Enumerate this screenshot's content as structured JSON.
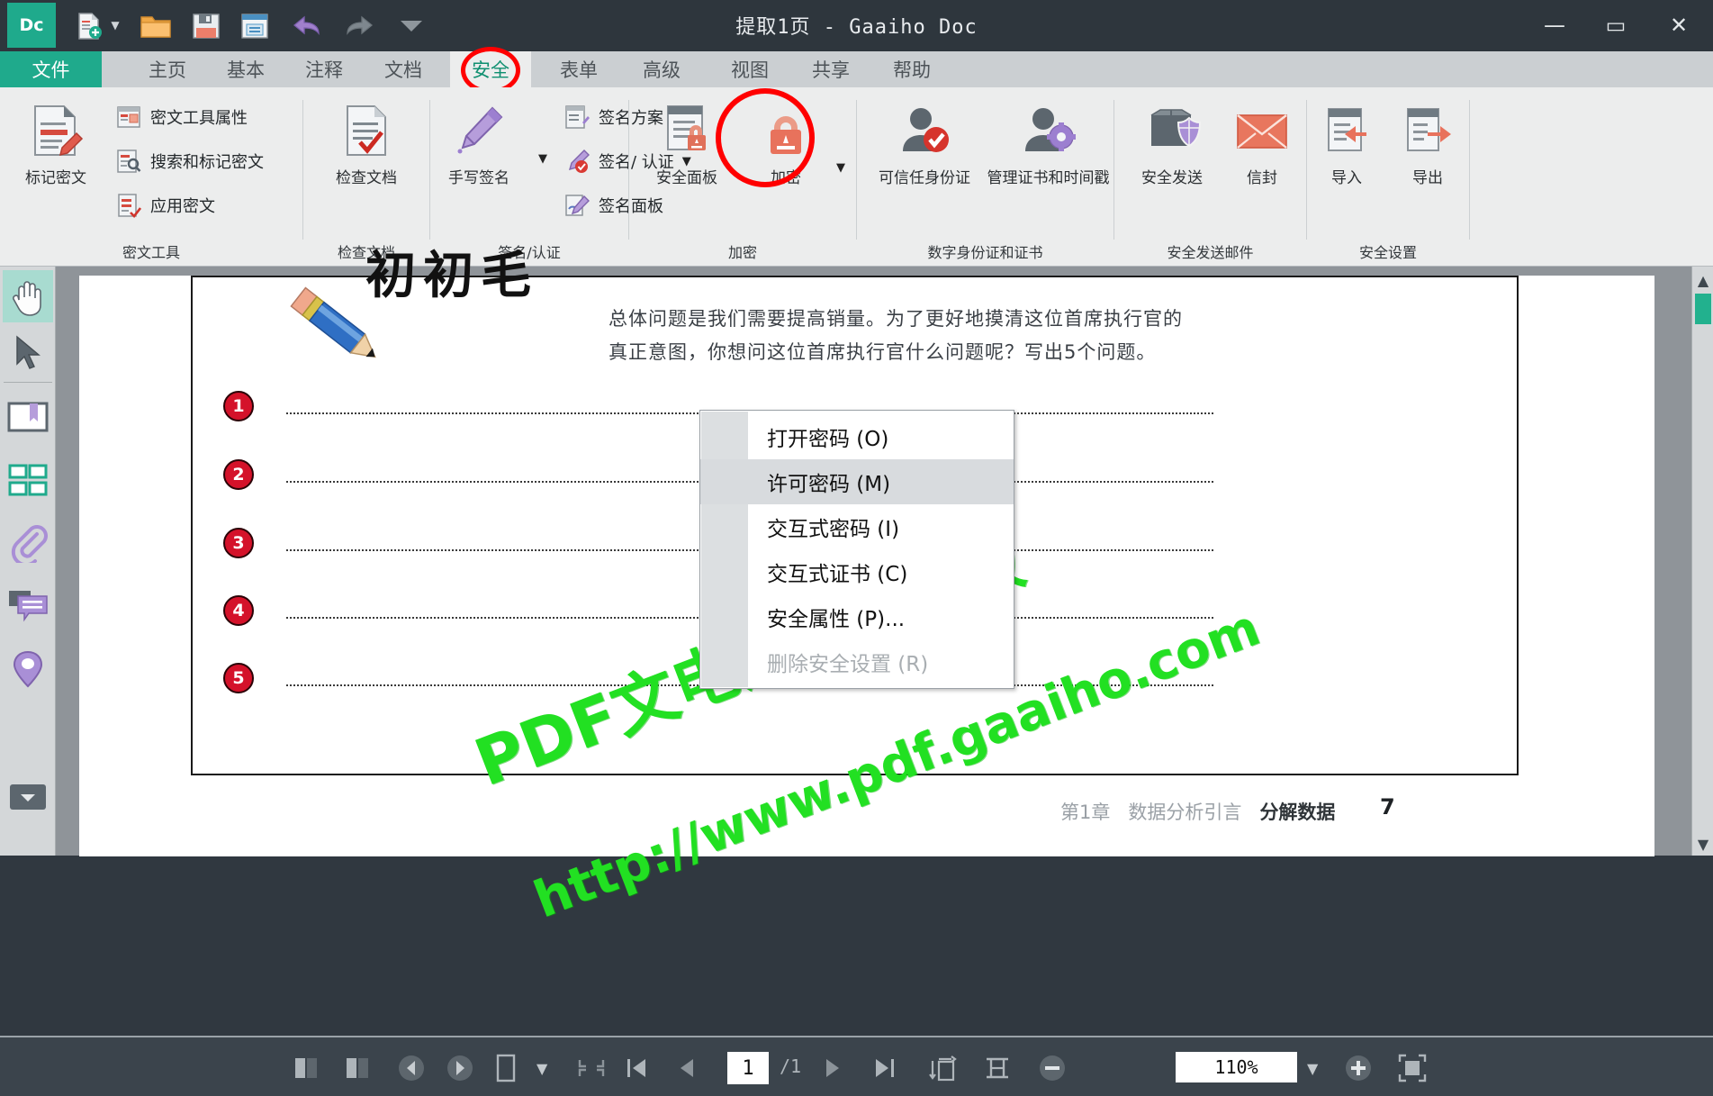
{
  "window": {
    "title": "提取1页 - Gaaiho Doc",
    "logo": "Dc",
    "minimize": "—",
    "maximize": "▭",
    "close": "✕"
  },
  "quick_access": [
    {
      "name": "new-document-icon",
      "label": "新建"
    },
    {
      "name": "open-folder-icon",
      "label": "打开"
    },
    {
      "name": "save-icon",
      "label": "保存"
    },
    {
      "name": "print-icon",
      "label": "打印"
    },
    {
      "name": "undo-icon",
      "label": "撤销"
    },
    {
      "name": "redo-icon",
      "label": "重做"
    },
    {
      "name": "customize-caret-icon",
      "label": "自定义"
    }
  ],
  "tabs": [
    {
      "label": "文件",
      "state": "file"
    },
    {
      "label": "主页",
      "state": "normal"
    },
    {
      "label": "基本",
      "state": "normal"
    },
    {
      "label": "注释",
      "state": "normal"
    },
    {
      "label": "文档",
      "state": "normal"
    },
    {
      "label": "安全",
      "state": "active"
    },
    {
      "label": "表单",
      "state": "normal"
    },
    {
      "label": "高级",
      "state": "normal"
    },
    {
      "label": "视图",
      "state": "normal"
    },
    {
      "label": "共享",
      "state": "normal"
    },
    {
      "label": "帮助",
      "state": "normal"
    }
  ],
  "ribbon": {
    "groups": [
      {
        "label": "密文工具",
        "big": [
          {
            "label": "标记密文",
            "icon": "redact-document-icon"
          }
        ],
        "small": [
          {
            "label": "密文工具属性",
            "icon": "redact-properties-icon"
          },
          {
            "label": "搜索和标记密文",
            "icon": "search-redact-icon"
          },
          {
            "label": "应用密文",
            "icon": "apply-redact-icon"
          }
        ]
      },
      {
        "label": "检查文档",
        "big": [
          {
            "label": "检查文档",
            "icon": "inspect-document-icon"
          }
        ],
        "small": []
      },
      {
        "label": "签名/认证",
        "big": [
          {
            "label": "手写签名",
            "icon": "handwritten-signature-icon"
          }
        ],
        "small": [
          {
            "label": "签名方案",
            "icon": "signature-scheme-icon"
          },
          {
            "label": "签名/ 认证",
            "icon": "sign-certify-icon",
            "caret": true
          },
          {
            "label": "签名面板",
            "icon": "signature-panel-icon"
          }
        ]
      },
      {
        "label": "加密",
        "big": [
          {
            "label": "安全面板",
            "icon": "security-panel-icon"
          },
          {
            "label": "加密",
            "icon": "encrypt-lock-icon",
            "caret": true,
            "highlighted": true
          }
        ],
        "small": []
      },
      {
        "label": "数字身份证和证书",
        "big": [
          {
            "label": "可信任身份证",
            "icon": "trusted-identity-icon"
          },
          {
            "label": "管理证书和时间戳",
            "icon": "manage-certificates-icon"
          }
        ],
        "small": []
      },
      {
        "label": "安全发送邮件",
        "big": [
          {
            "label": "安全发送",
            "icon": "secure-send-icon"
          },
          {
            "label": "信封",
            "icon": "envelope-icon"
          }
        ],
        "small": []
      },
      {
        "label": "安全设置",
        "big": [
          {
            "label": "导入",
            "icon": "import-icon"
          },
          {
            "label": "导出",
            "icon": "export-icon"
          }
        ],
        "small": []
      }
    ]
  },
  "left_rail": [
    {
      "name": "hand-tool-icon",
      "label": "手形工具",
      "selected": true
    },
    {
      "name": "select-arrow-icon",
      "label": "选择工具",
      "selected": false
    },
    {
      "name": "bookmark-panel-icon",
      "label": "书签",
      "selected": false
    },
    {
      "name": "thumbnails-panel-icon",
      "label": "页面缩略图",
      "selected": false
    },
    {
      "name": "attachment-panel-icon",
      "label": "附件",
      "selected": false
    },
    {
      "name": "comment-panel-icon",
      "label": "注释",
      "selected": false
    },
    {
      "name": "destination-panel-icon",
      "label": "目标",
      "selected": false
    },
    {
      "name": "collapse-rail-icon",
      "label": "收起",
      "selected": false
    }
  ],
  "menu": {
    "items": [
      {
        "label": "打开密码 (O)",
        "state": "normal",
        "name": "menu-open-password"
      },
      {
        "label": "许可密码 (M)",
        "state": "highlighted",
        "name": "menu-permission-password"
      },
      {
        "label": "交互式密码 (I)",
        "state": "normal",
        "name": "menu-interactive-password"
      },
      {
        "label": "交互式证书 (C)",
        "state": "normal",
        "name": "menu-interactive-certificate"
      },
      {
        "label": "安全属性 (P)...",
        "state": "normal",
        "name": "menu-security-properties"
      },
      {
        "label": "删除安全设置 (R)",
        "state": "disabled",
        "name": "menu-remove-security"
      }
    ]
  },
  "document": {
    "header_cjk": "初初毛",
    "body_text": "总体问题是我们需要提高销量。为了更好地摸清这位首席执行官的真正意图，你想问这位首席执行官什么问题呢？写出5个问题。",
    "bullets": [
      "1",
      "2",
      "3",
      "4",
      "5"
    ],
    "footer_chapter": "第1章",
    "footer_section": "数据分析引言",
    "footer_topic": "分解数据",
    "footer_page": "7",
    "watermark_line1": "PDF文电通3专业版",
    "watermark_line2": "http://www.pdf.gaaiho.com"
  },
  "statusbar": {
    "buttons": [
      {
        "name": "page-layout-single-icon",
        "glyph": "▛"
      },
      {
        "name": "page-layout-continuous-icon",
        "glyph": "▜"
      },
      {
        "name": "previous-view-icon",
        "glyph": "←"
      },
      {
        "name": "next-view-icon",
        "glyph": "→"
      },
      {
        "name": "single-page-view-icon",
        "glyph": "▯"
      },
      {
        "name": "view-mode-caret-icon",
        "glyph": "▼"
      },
      {
        "name": "fit-page-icon",
        "glyph": "⇱"
      },
      {
        "name": "first-page-icon",
        "glyph": "|◀"
      },
      {
        "name": "previous-page-icon",
        "glyph": "◀"
      }
    ],
    "buttons_right": [
      {
        "name": "next-page-icon",
        "glyph": "▶"
      },
      {
        "name": "last-page-icon",
        "glyph": "▶|"
      },
      {
        "name": "rotate-view-icon",
        "glyph": "↻"
      },
      {
        "name": "fit-width-icon",
        "glyph": "↔"
      },
      {
        "name": "zoom-out-icon",
        "glyph": "⊖"
      }
    ],
    "current_page": "1",
    "total_pages": "/1",
    "zoom_level": "110%",
    "zoom_caret": "▼",
    "zoom_in": "⊕",
    "fullscreen": "⛶"
  },
  "colors": {
    "accent_teal": "#1faa8c",
    "highlight_red": "#ff0000",
    "titlebar": "#2e363d",
    "ribbon_bg": "#eceded",
    "watermark_green": "#22e022"
  }
}
